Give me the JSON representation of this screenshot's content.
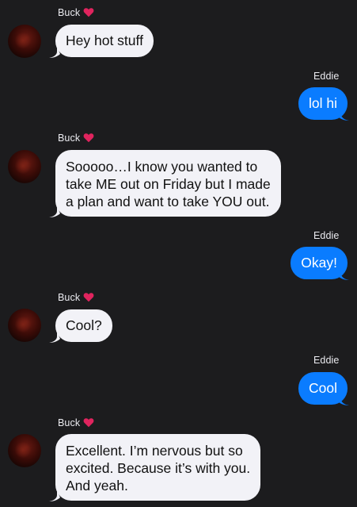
{
  "contacts": {
    "buck": "Buck",
    "eddie": "Eddie"
  },
  "colors": {
    "background": "#1c1c1e",
    "incoming_bubble": "#f2f2f7",
    "outgoing_bubble": "#0a7cff",
    "heart": "#e0245e"
  },
  "messages": [
    {
      "from": "Buck",
      "text": "Hey hot stuff"
    },
    {
      "from": "Eddie",
      "text": "lol hi"
    },
    {
      "from": "Buck",
      "lines": [
        "Sooooo…I know you wanted to",
        "take ME out on Friday but I made",
        "a plan and want to take YOU out."
      ]
    },
    {
      "from": "Eddie",
      "text": "Okay!"
    },
    {
      "from": "Buck",
      "text": "Cool?"
    },
    {
      "from": "Eddie",
      "text": "Cool"
    },
    {
      "from": "Buck",
      "lines": [
        "Excellent. I’m nervous but so",
        "excited. Because it’s with you.",
        "And yeah."
      ]
    }
  ]
}
